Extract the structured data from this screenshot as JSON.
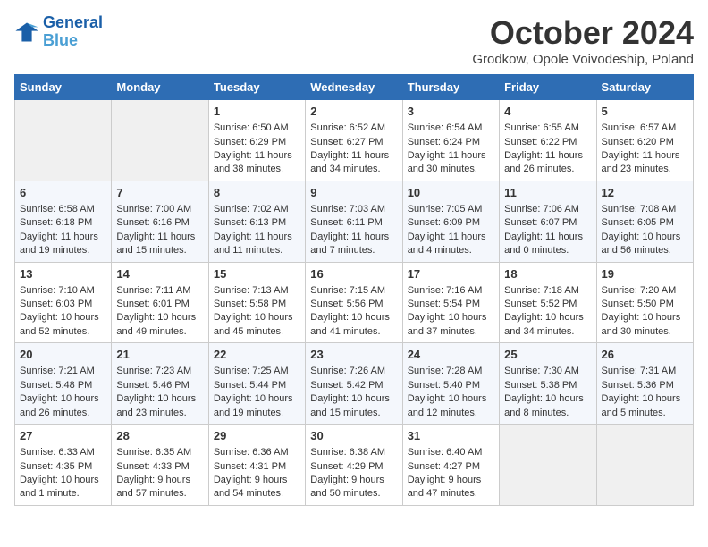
{
  "header": {
    "logo_line1": "General",
    "logo_line2": "Blue",
    "month_title": "October 2024",
    "location": "Grodkow, Opole Voivodeship, Poland"
  },
  "weekdays": [
    "Sunday",
    "Monday",
    "Tuesday",
    "Wednesday",
    "Thursday",
    "Friday",
    "Saturday"
  ],
  "weeks": [
    [
      {
        "day": "",
        "empty": true
      },
      {
        "day": "",
        "empty": true
      },
      {
        "day": "1",
        "sunrise": "6:50 AM",
        "sunset": "6:29 PM",
        "daylight": "11 hours and 38 minutes."
      },
      {
        "day": "2",
        "sunrise": "6:52 AM",
        "sunset": "6:27 PM",
        "daylight": "11 hours and 34 minutes."
      },
      {
        "day": "3",
        "sunrise": "6:54 AM",
        "sunset": "6:24 PM",
        "daylight": "11 hours and 30 minutes."
      },
      {
        "day": "4",
        "sunrise": "6:55 AM",
        "sunset": "6:22 PM",
        "daylight": "11 hours and 26 minutes."
      },
      {
        "day": "5",
        "sunrise": "6:57 AM",
        "sunset": "6:20 PM",
        "daylight": "11 hours and 23 minutes."
      }
    ],
    [
      {
        "day": "6",
        "sunrise": "6:58 AM",
        "sunset": "6:18 PM",
        "daylight": "11 hours and 19 minutes."
      },
      {
        "day": "7",
        "sunrise": "7:00 AM",
        "sunset": "6:16 PM",
        "daylight": "11 hours and 15 minutes."
      },
      {
        "day": "8",
        "sunrise": "7:02 AM",
        "sunset": "6:13 PM",
        "daylight": "11 hours and 11 minutes."
      },
      {
        "day": "9",
        "sunrise": "7:03 AM",
        "sunset": "6:11 PM",
        "daylight": "11 hours and 7 minutes."
      },
      {
        "day": "10",
        "sunrise": "7:05 AM",
        "sunset": "6:09 PM",
        "daylight": "11 hours and 4 minutes."
      },
      {
        "day": "11",
        "sunrise": "7:06 AM",
        "sunset": "6:07 PM",
        "daylight": "11 hours and 0 minutes."
      },
      {
        "day": "12",
        "sunrise": "7:08 AM",
        "sunset": "6:05 PM",
        "daylight": "10 hours and 56 minutes."
      }
    ],
    [
      {
        "day": "13",
        "sunrise": "7:10 AM",
        "sunset": "6:03 PM",
        "daylight": "10 hours and 52 minutes."
      },
      {
        "day": "14",
        "sunrise": "7:11 AM",
        "sunset": "6:01 PM",
        "daylight": "10 hours and 49 minutes."
      },
      {
        "day": "15",
        "sunrise": "7:13 AM",
        "sunset": "5:58 PM",
        "daylight": "10 hours and 45 minutes."
      },
      {
        "day": "16",
        "sunrise": "7:15 AM",
        "sunset": "5:56 PM",
        "daylight": "10 hours and 41 minutes."
      },
      {
        "day": "17",
        "sunrise": "7:16 AM",
        "sunset": "5:54 PM",
        "daylight": "10 hours and 37 minutes."
      },
      {
        "day": "18",
        "sunrise": "7:18 AM",
        "sunset": "5:52 PM",
        "daylight": "10 hours and 34 minutes."
      },
      {
        "day": "19",
        "sunrise": "7:20 AM",
        "sunset": "5:50 PM",
        "daylight": "10 hours and 30 minutes."
      }
    ],
    [
      {
        "day": "20",
        "sunrise": "7:21 AM",
        "sunset": "5:48 PM",
        "daylight": "10 hours and 26 minutes."
      },
      {
        "day": "21",
        "sunrise": "7:23 AM",
        "sunset": "5:46 PM",
        "daylight": "10 hours and 23 minutes."
      },
      {
        "day": "22",
        "sunrise": "7:25 AM",
        "sunset": "5:44 PM",
        "daylight": "10 hours and 19 minutes."
      },
      {
        "day": "23",
        "sunrise": "7:26 AM",
        "sunset": "5:42 PM",
        "daylight": "10 hours and 15 minutes."
      },
      {
        "day": "24",
        "sunrise": "7:28 AM",
        "sunset": "5:40 PM",
        "daylight": "10 hours and 12 minutes."
      },
      {
        "day": "25",
        "sunrise": "7:30 AM",
        "sunset": "5:38 PM",
        "daylight": "10 hours and 8 minutes."
      },
      {
        "day": "26",
        "sunrise": "7:31 AM",
        "sunset": "5:36 PM",
        "daylight": "10 hours and 5 minutes."
      }
    ],
    [
      {
        "day": "27",
        "sunrise": "6:33 AM",
        "sunset": "4:35 PM",
        "daylight": "10 hours and 1 minute."
      },
      {
        "day": "28",
        "sunrise": "6:35 AM",
        "sunset": "4:33 PM",
        "daylight": "9 hours and 57 minutes."
      },
      {
        "day": "29",
        "sunrise": "6:36 AM",
        "sunset": "4:31 PM",
        "daylight": "9 hours and 54 minutes."
      },
      {
        "day": "30",
        "sunrise": "6:38 AM",
        "sunset": "4:29 PM",
        "daylight": "9 hours and 50 minutes."
      },
      {
        "day": "31",
        "sunrise": "6:40 AM",
        "sunset": "4:27 PM",
        "daylight": "9 hours and 47 minutes."
      },
      {
        "day": "",
        "empty": true
      },
      {
        "day": "",
        "empty": true
      }
    ]
  ],
  "labels": {
    "sunrise_label": "Sunrise:",
    "sunset_label": "Sunset:",
    "daylight_label": "Daylight:"
  }
}
